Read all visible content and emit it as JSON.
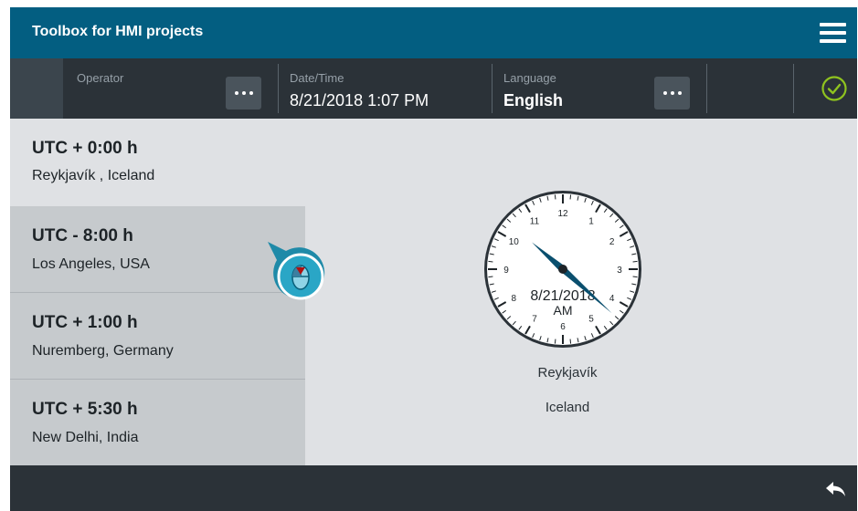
{
  "header": {
    "title": "Toolbox for HMI projects",
    "menu_icon": "hamburger-menu-icon"
  },
  "infobar": {
    "operator_label": "Operator",
    "datetime_label": "Date/Time",
    "datetime_value": "8/21/2018 1:07 PM",
    "language_label": "Language",
    "language_value": "English",
    "confirm_icon": "check-circle-icon",
    "colors": {
      "confirm": "#8fc31f",
      "bar": "#2b3238"
    }
  },
  "timezones": [
    {
      "utc": "UTC + 0:00 h",
      "city": "Reykjavík , Iceland",
      "selected": true
    },
    {
      "utc": "UTC - 8:00 h",
      "city": "Los Angeles, USA",
      "selected": false
    },
    {
      "utc": "UTC + 1:00 h",
      "city": "Nuremberg, Germany",
      "selected": false
    },
    {
      "utc": "UTC + 5:30 h",
      "city": "New Delhi, India",
      "selected": false
    }
  ],
  "clock": {
    "date": "8/21/2018",
    "ampm": "AM",
    "city": "Reykjavík",
    "country": "Iceland",
    "hour_numbers": [
      "12",
      "1",
      "2",
      "3",
      "4",
      "5",
      "6",
      "7",
      "8",
      "9",
      "10",
      "11"
    ],
    "time": "10:22",
    "hand_color": "#0a4f6e"
  },
  "footer": {
    "back_icon": "back-arrow-icon"
  },
  "colors": {
    "brand": "#035e81",
    "background": "#dfe1e4"
  }
}
